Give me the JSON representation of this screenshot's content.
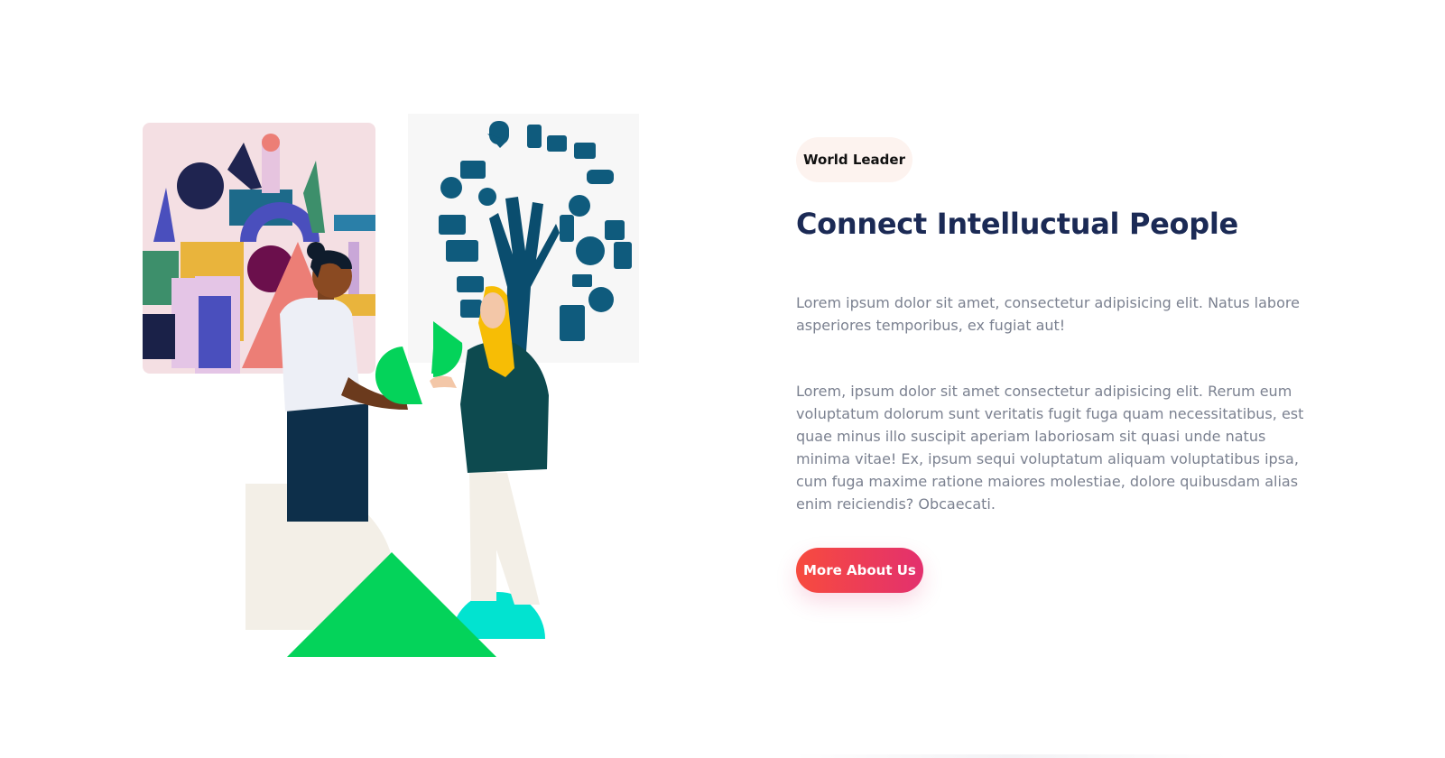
{
  "section": {
    "tag_label": "World Leader",
    "heading": "Connect Intelluctual People",
    "paragraph_1": "Lorem ipsum dolor sit amet, consectetur adipisicing elit. Natus labore asperiores temporibus, ex fugiat aut!",
    "paragraph_2": "Lorem, ipsum dolor sit amet consectetur adipisicing elit. Rerum eum voluptatum dolorum sunt veritatis fugit fuga quam necessitatibus, est quae minus illo suscipit aperiam laboriosam sit quasi unde natus minima vitae! Ex, ipsum sequi voluptatum aliquam voluptatibus ipsa, cum fuga maxime ratione maiores molestiae, dolore quibusdam alias enim reiciendis? Obcaecati.",
    "cta_label": "More About Us"
  },
  "illustration": {
    "icons": [
      "people-collage-image",
      "gadget-tree-image",
      "two-people-illustration"
    ]
  },
  "colors": {
    "heading": "#1b2a55",
    "body_text": "#7b8190",
    "tag_bg": "#fdf3ef",
    "cta_gradient_start": "#f74b3e",
    "cta_gradient_end": "#e3306e",
    "green": "#04d35a",
    "teal": "#02e3d0",
    "navy": "#0d2f4a"
  }
}
